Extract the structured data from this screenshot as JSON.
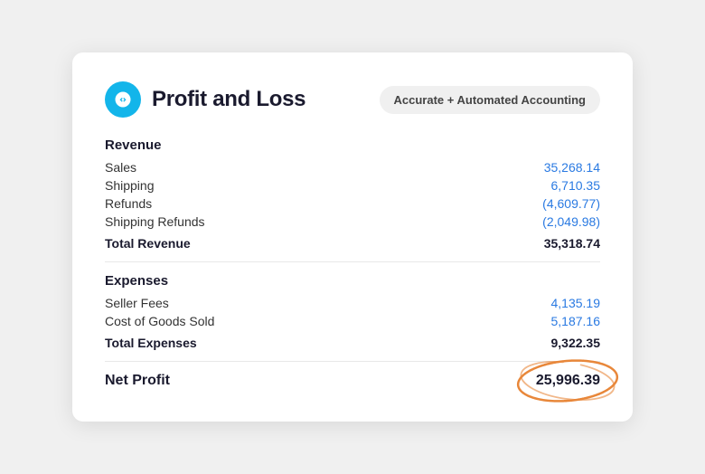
{
  "header": {
    "title": "Profit and Loss",
    "badge": "Accurate + Automated Accounting",
    "logo_alt": "Xero logo"
  },
  "revenue": {
    "section_label": "Revenue",
    "items": [
      {
        "name": "Sales",
        "value": "35,268.14",
        "negative": false
      },
      {
        "name": "Shipping",
        "value": "6,710.35",
        "negative": false
      },
      {
        "name": "Refunds",
        "value": "(4,609.77)",
        "negative": true
      },
      {
        "name": "Shipping Refunds",
        "value": "(2,049.98)",
        "negative": true
      }
    ],
    "total_label": "Total Revenue",
    "total_value": "35,318.74"
  },
  "expenses": {
    "section_label": "Expenses",
    "items": [
      {
        "name": "Seller Fees",
        "value": "4,135.19",
        "negative": false
      },
      {
        "name": "Cost of Goods Sold",
        "value": "5,187.16",
        "negative": false
      }
    ],
    "total_label": "Total Expenses",
    "total_value": "9,322.35"
  },
  "net_profit": {
    "label": "Net Profit",
    "value": "25,996.39"
  }
}
